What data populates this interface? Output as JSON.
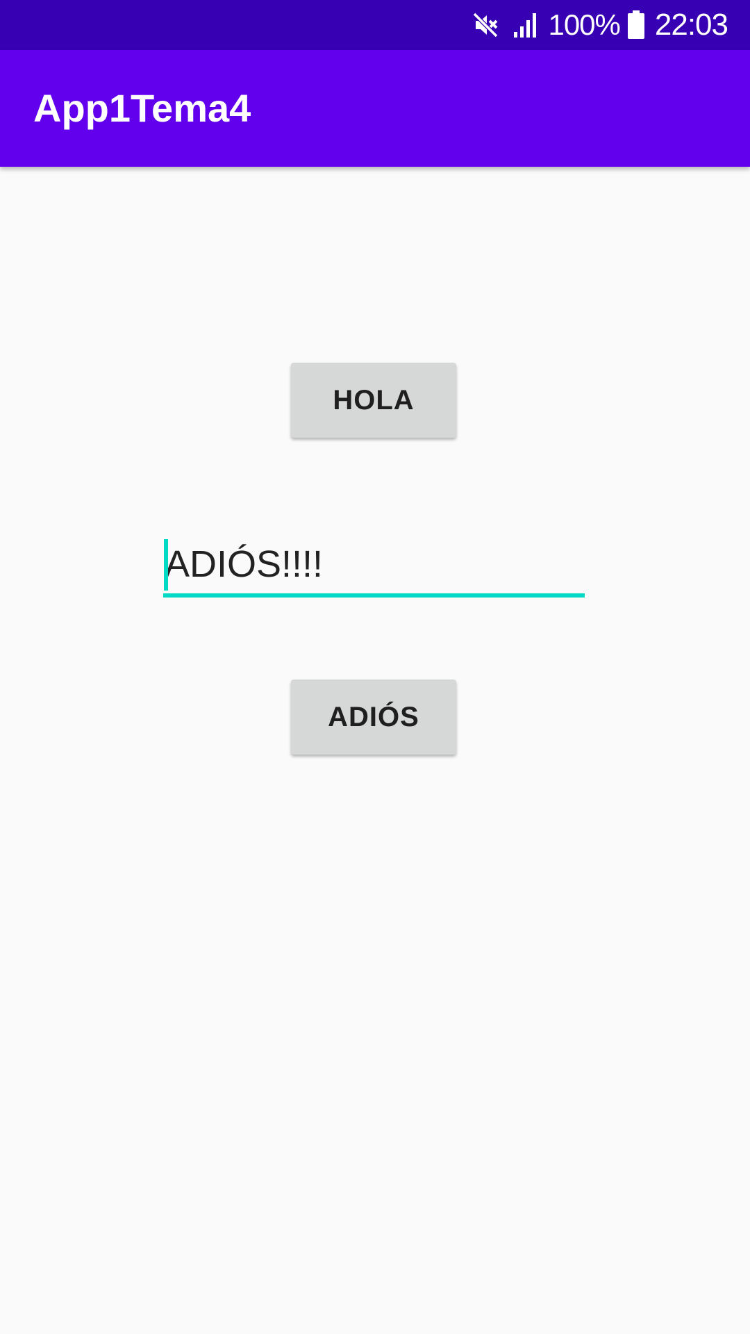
{
  "status_bar": {
    "icons": [
      "mute-icon",
      "signal-icon",
      "battery-icon"
    ],
    "battery_percent": "100%",
    "time": "22:03",
    "background": "#3700b3"
  },
  "app_bar": {
    "title": "App1Tema4",
    "background": "#6200ee"
  },
  "main": {
    "hola_button_label": "HOLA",
    "text_field_value": "ADIÓS!!!!",
    "adios_button_label": "ADIÓS"
  },
  "colors": {
    "accent": "#03dac5",
    "button_bg": "#d6d7d7",
    "page_bg": "#fafafa"
  }
}
